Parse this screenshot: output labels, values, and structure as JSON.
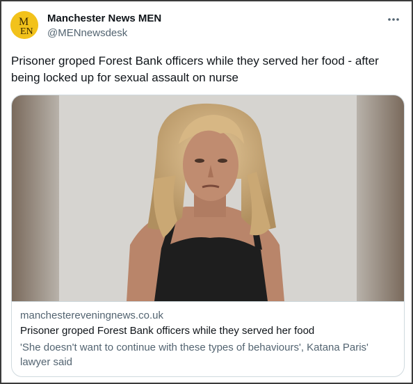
{
  "author": {
    "display_name": "Manchester News MEN",
    "handle": "@MENnewsdesk",
    "avatar_icon": "men-logo-icon",
    "avatar_color": "#f2c21b"
  },
  "tweet": {
    "text": "Prisoner groped Forest Bank officers while they served her food - after being locked up for sexual assault on nurse"
  },
  "more_icon": "ellipsis-icon",
  "card": {
    "domain": "manchestereveningnews.co.uk",
    "title": "Prisoner groped Forest Bank officers while they served her food",
    "description": "'She doesn't want to continue with these types of behaviours', Katana Paris' lawyer said",
    "image_subject": "mugshot-photo"
  },
  "colors": {
    "text": "#0f1419",
    "secondary": "#536471",
    "border": "#cfd9de"
  }
}
